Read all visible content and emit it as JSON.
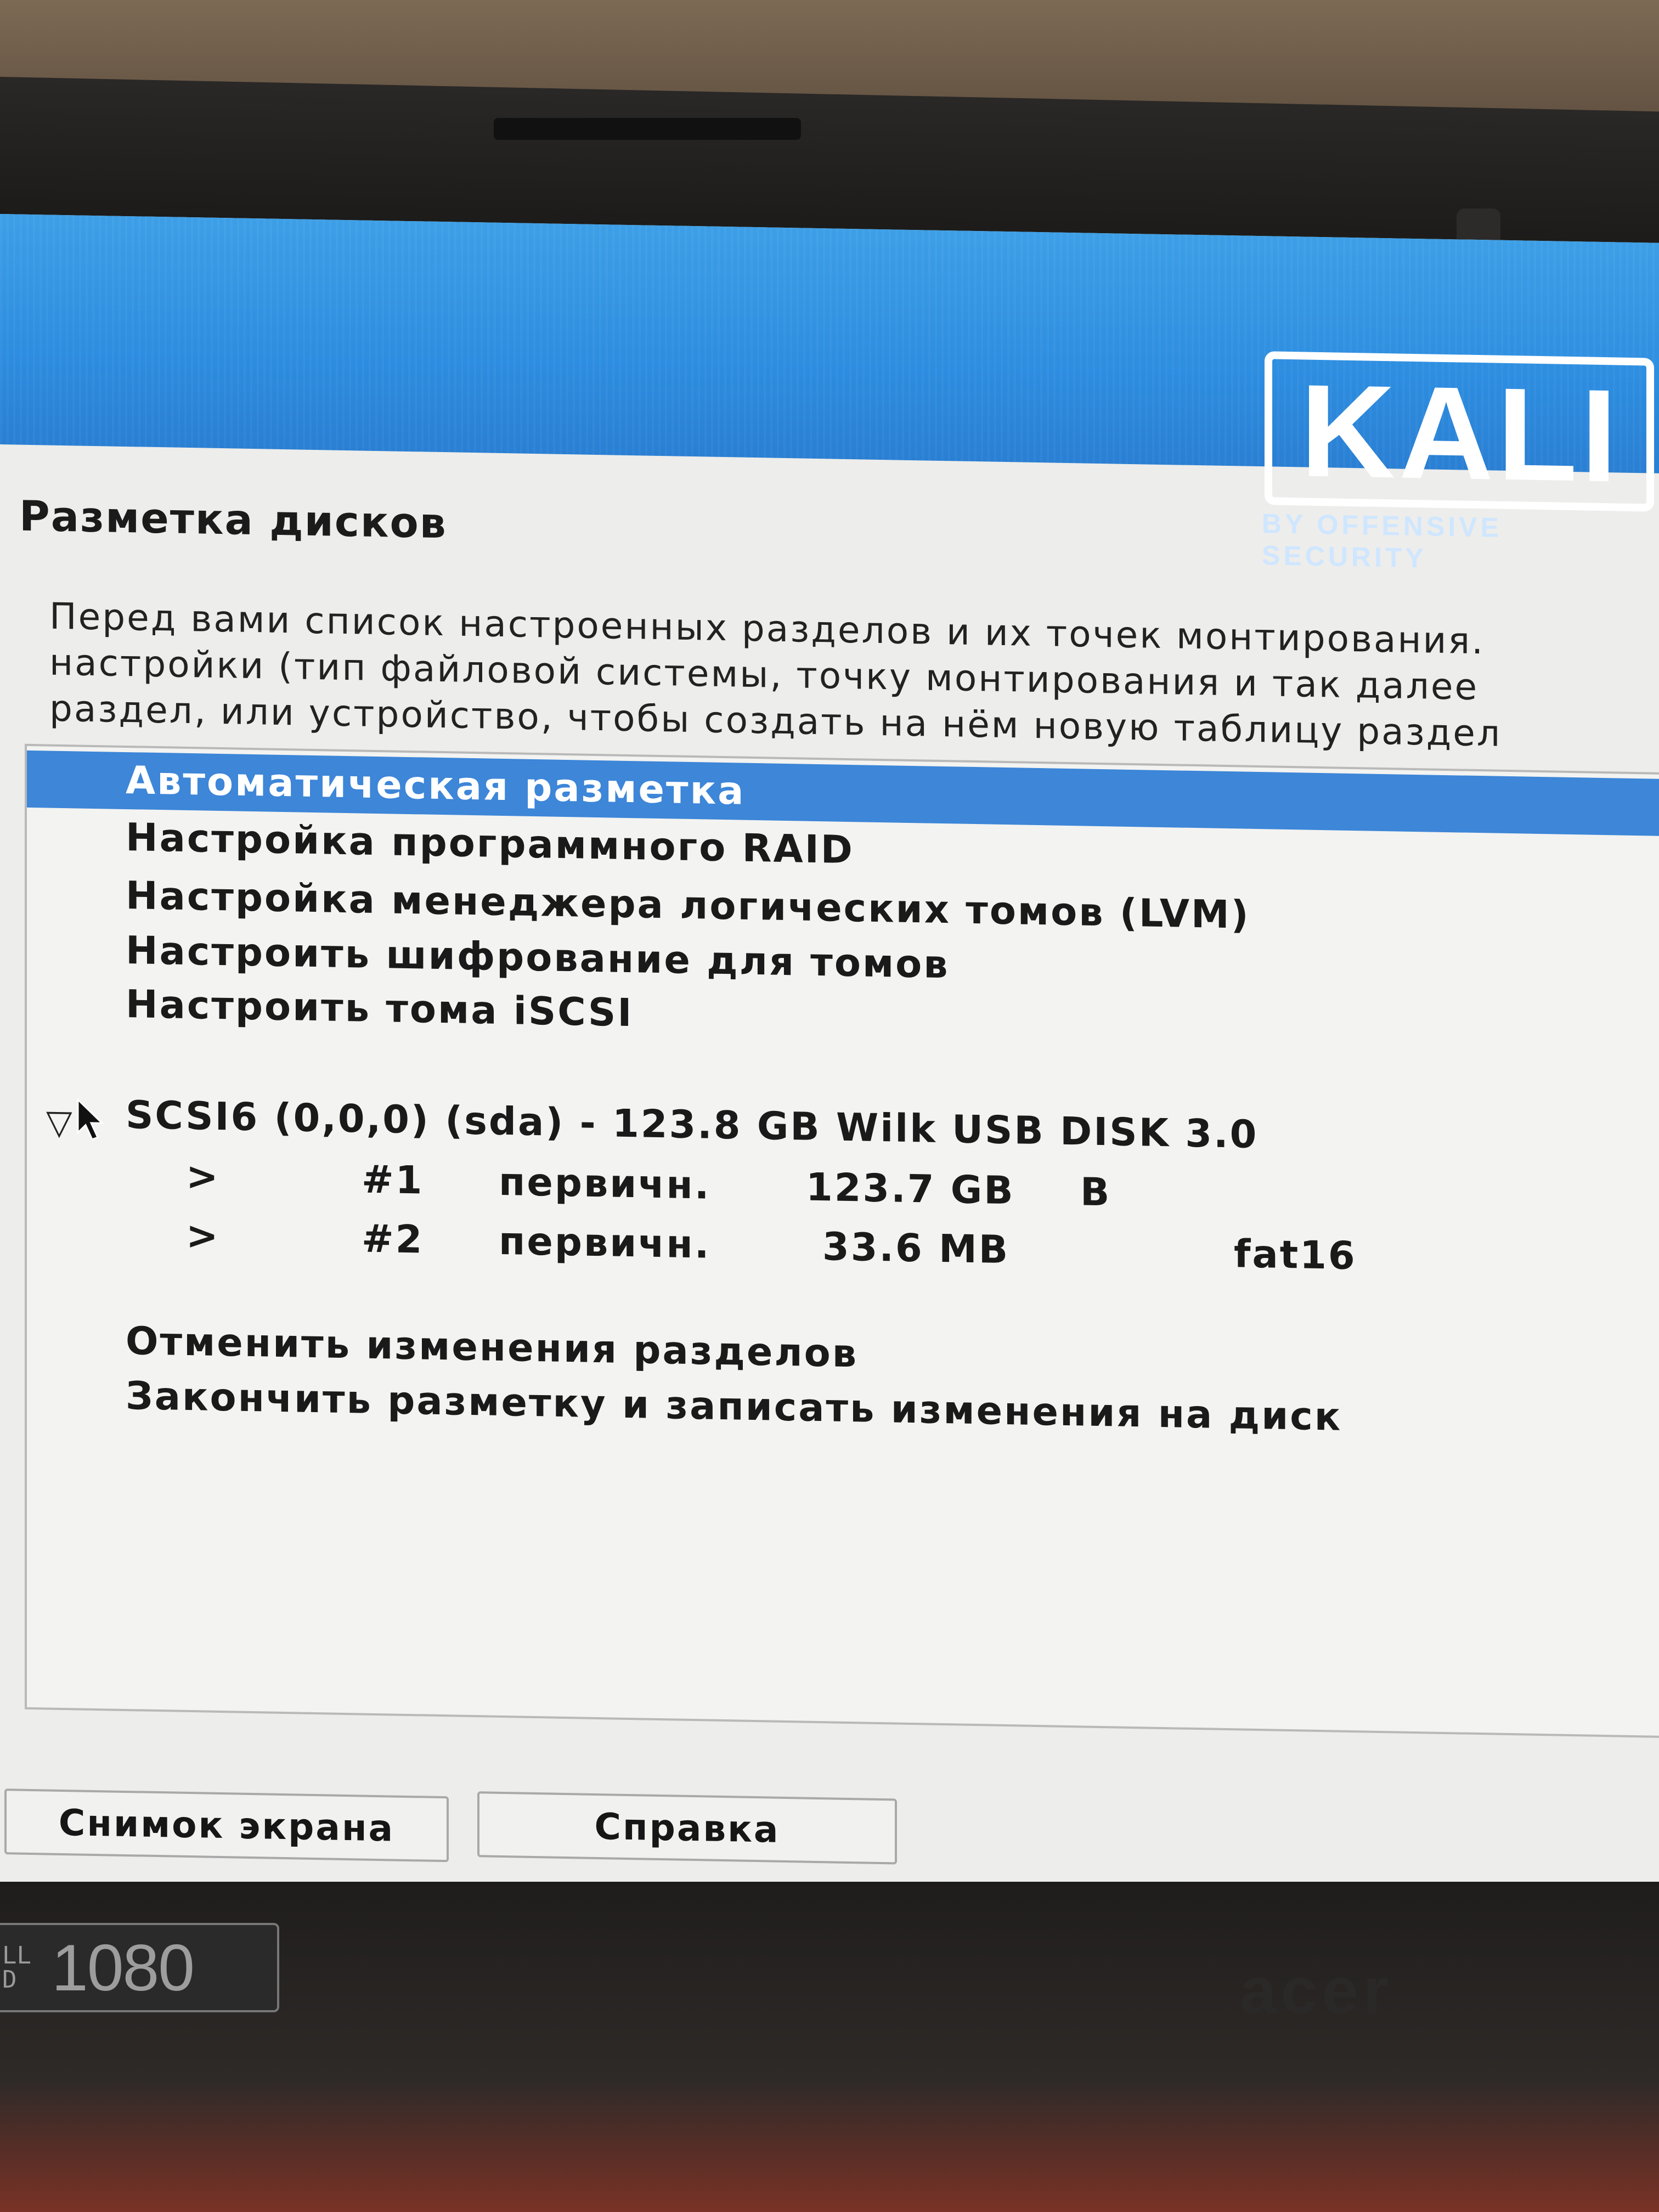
{
  "installer": {
    "page_title": "Разметка дисков",
    "logo": {
      "text": "KALI",
      "subtitle": "BY OFFENSIVE SECURITY"
    },
    "description": [
      "Перед вами список настроенных разделов и их точек монтирования.",
      "настройки (тип файловой системы, точку монтирования и так далее",
      "раздел, или устройство, чтобы создать на нём новую таблицу раздел"
    ],
    "menu": [
      {
        "label": "Автоматическая разметка",
        "selected": true
      },
      {
        "label": "Настройка программного RAID",
        "selected": false
      },
      {
        "label": "Настройка менеджера логических томов (LVM)",
        "selected": false
      },
      {
        "label": "Настроить шифрование для томов",
        "selected": false
      },
      {
        "label": "Настроить тома iSCSI",
        "selected": false
      }
    ],
    "disk": {
      "label": "SCSI6 (0,0,0) (sda) - 123.8 GB Wilk USB DISK 3.0",
      "partitions": [
        {
          "arrow": ">",
          "number": "#1",
          "type": "первичн.",
          "size": "123.7 GB",
          "flag": "B",
          "fs": ""
        },
        {
          "arrow": ">",
          "number": "#2",
          "type": "первичн.",
          "size": "33.6 MB",
          "flag": "",
          "fs": "fat16"
        }
      ]
    },
    "actions": [
      {
        "label": "Отменить изменения разделов"
      },
      {
        "label": "Закончить разметку и записать изменения на диск"
      }
    ],
    "buttons": {
      "screenshot": "Снимок экрана",
      "help": "Справка"
    }
  },
  "laptop": {
    "sticker": {
      "left": "LL\nD",
      "resolution": "1080"
    },
    "brand": "acer"
  }
}
